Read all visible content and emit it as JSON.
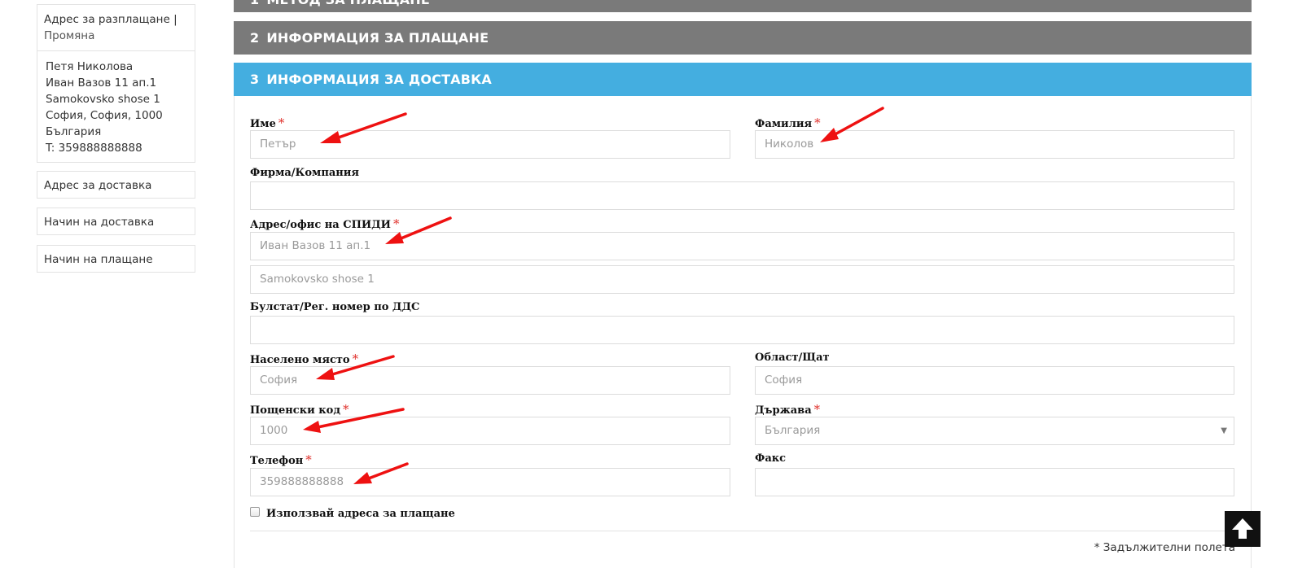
{
  "sidebar": {
    "billing_address_title": "Адрес за разплащане",
    "separator": "|",
    "change_link": "Промяна",
    "address_lines": [
      "Петя Николова",
      "Иван Вазов 11 ап.1",
      "Samokovsko shose 1",
      "София, София, 1000",
      "България",
      "T: 359888888888"
    ],
    "items": [
      {
        "label": "Адрес за доставка"
      },
      {
        "label": "Начин на доставка"
      },
      {
        "label": "Начин на плащане"
      }
    ]
  },
  "steps": [
    {
      "num": "1",
      "title": "МЕТОД ЗА ПЛАЩАНЕ"
    },
    {
      "num": "2",
      "title": "ИНФОРМАЦИЯ ЗА ПЛАЩАНЕ"
    },
    {
      "num": "3",
      "title": "ИНФОРМАЦИЯ ЗА ДОСТАВКА"
    }
  ],
  "form": {
    "required_mark": "*",
    "first_name": {
      "label": "Име",
      "placeholder": "Петър"
    },
    "last_name": {
      "label": "Фамилия",
      "placeholder": "Николов"
    },
    "company": {
      "label": "Фирма/Компания",
      "value": ""
    },
    "address": {
      "label": "Адрес/офис на СПИДИ",
      "line1_placeholder": "Иван Вазов 11 ап.1",
      "line2_placeholder": "Samokovsko shose 1"
    },
    "vat": {
      "label": "Булстат/Рег. номер по ДДС",
      "value": ""
    },
    "city": {
      "label": "Населено място",
      "placeholder": "София"
    },
    "region": {
      "label": "Област/Щат",
      "placeholder": "София"
    },
    "postcode": {
      "label": "Пощенски код",
      "placeholder": "1000"
    },
    "country": {
      "label": "Държава",
      "selected": "България"
    },
    "phone": {
      "label": "Телефон",
      "placeholder": "359888888888"
    },
    "fax": {
      "label": "Факс",
      "value": ""
    },
    "use_billing_checkbox": {
      "label": "Използвай адреса за плащане",
      "checked": false
    },
    "required_note": "* Задължителни полета"
  },
  "colors": {
    "step_gray": "#7a7a7a",
    "step_blue": "#44aee0",
    "required": "#e0312c",
    "annotation_arrow": "#ee1111"
  },
  "icons": {
    "back_to_top": "arrow-up-icon",
    "select_caret": "chevron-down-icon"
  }
}
